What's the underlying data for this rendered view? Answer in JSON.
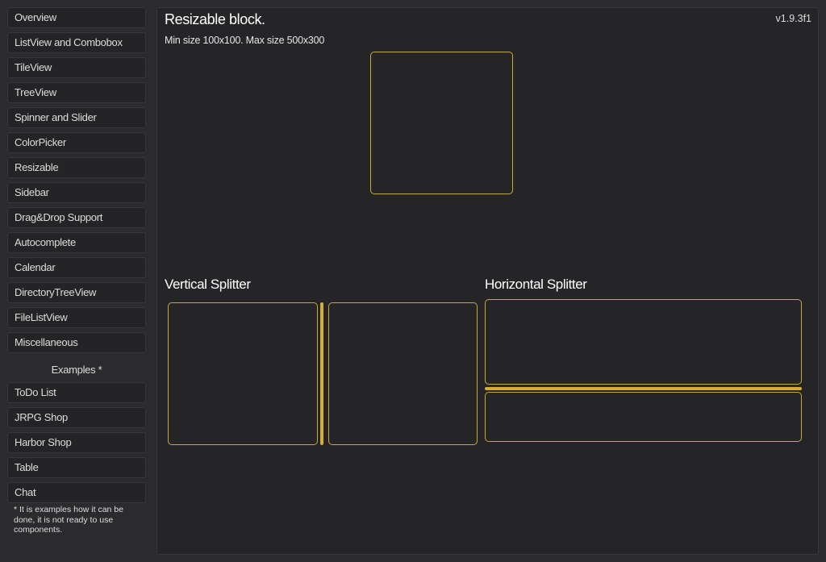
{
  "sidebar": {
    "items": [
      {
        "label": "Overview"
      },
      {
        "label": "ListView and Combobox"
      },
      {
        "label": "TileView"
      },
      {
        "label": "TreeView"
      },
      {
        "label": "Spinner and Slider"
      },
      {
        "label": "ColorPicker"
      },
      {
        "label": "Resizable"
      },
      {
        "label": "Sidebar"
      },
      {
        "label": "Drag&Drop Support"
      },
      {
        "label": "Autocomplete"
      },
      {
        "label": "Calendar"
      },
      {
        "label": "DirectoryTreeView"
      },
      {
        "label": "FileListView"
      },
      {
        "label": "Miscellaneous"
      }
    ],
    "examples_header": "Examples *",
    "examples": [
      {
        "label": "ToDo List"
      },
      {
        "label": "JRPG Shop"
      },
      {
        "label": "Harbor Shop"
      },
      {
        "label": "Table"
      },
      {
        "label": "Chat"
      }
    ],
    "note": "* It is examples how it can be done, it is not ready to use components."
  },
  "main": {
    "title": "Resizable block.",
    "version": "v1.9.3f1",
    "subtitle": "Min size 100x100. Max size 500x300",
    "vertical_splitter_title": "Vertical Splitter",
    "horizontal_splitter_title": "Horizontal Splitter"
  },
  "colors": {
    "accent": "#d4ad34",
    "panel_border": "#c9a73a",
    "background": "#2b2b2e",
    "panel_bg": "#252528"
  }
}
